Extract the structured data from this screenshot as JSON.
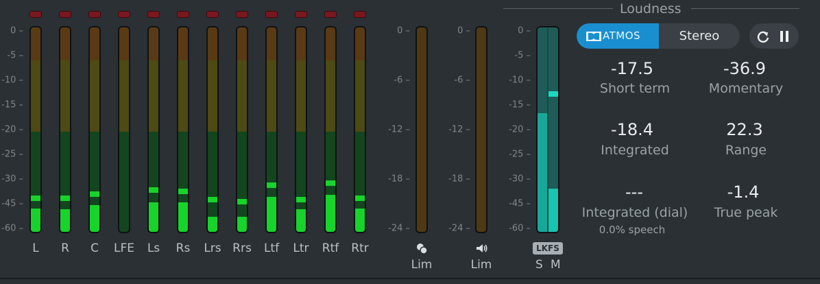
{
  "channel_scale": [
    "0",
    "-5",
    "-10",
    "-15",
    "-20",
    "-25",
    "-30",
    "-45",
    "-60"
  ],
  "lim_scale": [
    "0",
    "-6",
    "-12",
    "-18",
    "-24"
  ],
  "lkfs_scale": [
    "0",
    "-5",
    "-10",
    "-15",
    "-20",
    "-25",
    "-30",
    "-45",
    "-60"
  ],
  "channels": [
    {
      "label": "L",
      "level": 0.115,
      "peak": 0.15
    },
    {
      "label": "R",
      "level": 0.11,
      "peak": 0.15
    },
    {
      "label": "C",
      "level": 0.13,
      "peak": 0.17
    },
    {
      "label": "LFE",
      "level": 0.0,
      "peak": null
    },
    {
      "label": "Ls",
      "level": 0.145,
      "peak": 0.19
    },
    {
      "label": "Rs",
      "level": 0.145,
      "peak": 0.185
    },
    {
      "label": "Lrs",
      "level": 0.075,
      "peak": 0.145
    },
    {
      "label": "Rrs",
      "level": 0.075,
      "peak": 0.135
    },
    {
      "label": "Ltf",
      "level": 0.17,
      "peak": 0.215
    },
    {
      "label": "Ltr",
      "level": 0.11,
      "peak": 0.145
    },
    {
      "label": "Rtf",
      "level": 0.18,
      "peak": 0.225
    },
    {
      "label": "Rtr",
      "level": 0.115,
      "peak": 0.15
    }
  ],
  "limiters": [
    {
      "label": "Lim",
      "icon": "dialogue-icon"
    },
    {
      "label": "Lim",
      "icon": "speaker-icon"
    }
  ],
  "lkfs": {
    "badge": "LKFS",
    "s_label": "S",
    "m_label": "M",
    "short_level": 0.58,
    "momentary_level": 0.21,
    "momentary_peak": 0.66
  },
  "loudness": {
    "title": "Loudness",
    "mode_atmos": "ATMOS",
    "mode_stereo": "Stereo",
    "short_term_value": "-17.5",
    "short_term_label": "Short term",
    "momentary_value": "-36.9",
    "momentary_label": "Momentary",
    "integrated_value": "-18.4",
    "integrated_label": "Integrated",
    "range_value": "22.3",
    "range_label": "Range",
    "dial_value": "---",
    "dial_label": "Integrated (dial)",
    "speech_label": "0.0% speech",
    "truepeak_value": "-1.4",
    "truepeak_label": "True peak"
  },
  "colors": {
    "meter_fill": "#16d42a",
    "accent": "#1a8fcf",
    "lkfs_fill": "#17a89a"
  }
}
